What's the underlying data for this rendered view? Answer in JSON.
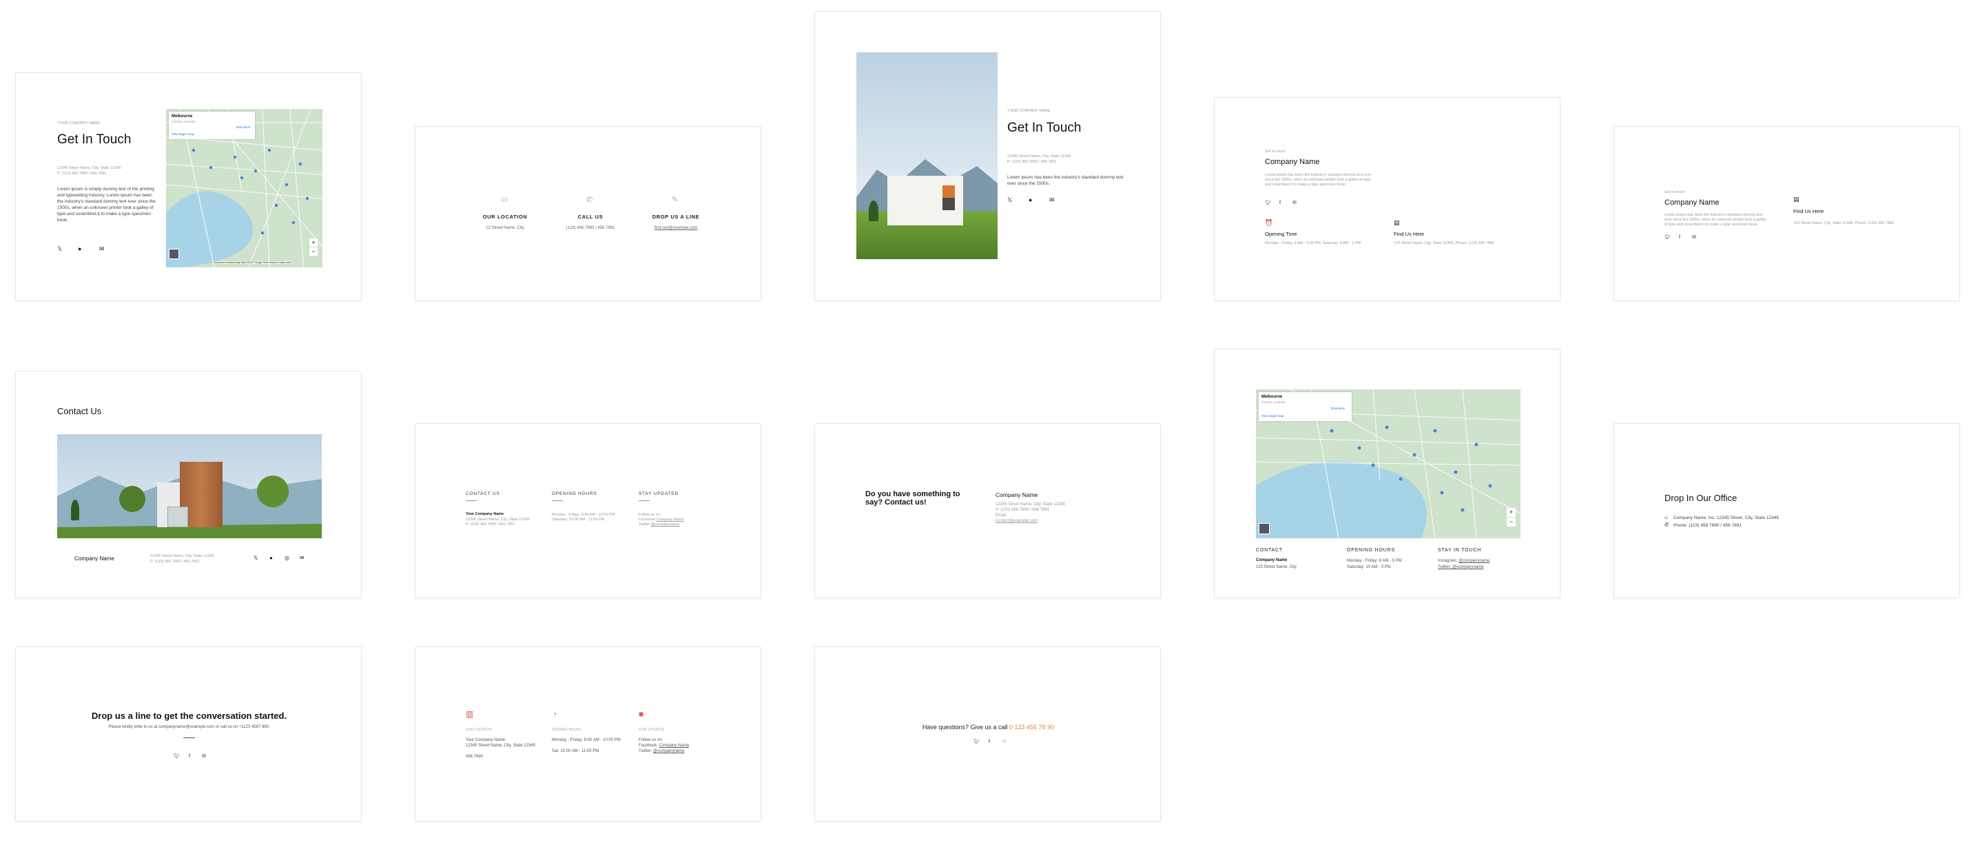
{
  "card1": {
    "eyebrow": "YOUR COMPANY NAME",
    "title": "Get In Touch",
    "addr1": "12345 Street Name, City, State 12345",
    "addr2": "P: (123) 456 7890 / 456 7891",
    "body": "Lorem ipsum is simply dummy text of the printing and typesetting industry. Lorem ipsum has been the industry's standard dummy text ever since the 1500s, when an unknown printer took a galley of type and scrambled it to make a type specimen book.",
    "map_city": "Melbourne",
    "map_region": "Victoria, Australia",
    "map_directions": "Directions",
    "map_view_larger": "View larger map",
    "map_footer": "Keyboard shortcuts   Map data ©2022 Google   Terms   Report a map error"
  },
  "card2": {
    "col1_title": "OUR LOCATION",
    "col1_text": "12 Street Name, City",
    "col2_title": "CALL US",
    "col2_text": "(123) 456 7890 / 456 7891",
    "col3_title": "DROP US A LINE",
    "col3_text": "first.last@example.com"
  },
  "card3": {
    "eyebrow": "YOUR COMPANY NAME",
    "title": "Get In Touch",
    "addr1": "12345 Street Name, City, State 12345",
    "addr2": "P: (123) 456 7890 / 456 7891",
    "body": "Lorem ipsum has been the industry's standard dummy text ever since the 1500s."
  },
  "card4": {
    "eyebrow": "Get in touch",
    "title": "Company Name",
    "body": "Lorem ipsum has been the industry's standard dummy text ever since the 1500s, when an unknown printer took a galley of type and scrambled it to make a type specimen book.",
    "col1_title": "Opening Time",
    "col1_text": "Monday - Friday: 8 AM - 9:30 PM, Saturday: 8 AM - 1 PM",
    "col2_title": "Find Us Here",
    "col2_text": "123 Street Name, City, State 12345, Phone: (123) 456 7890"
  },
  "card5": {
    "eyebrow": "Get in touch",
    "title": "Company Name",
    "body": "Lorem ipsum has been the industry's standard dummy text ever since the 1500s, when an unknown printer took a galley of type and scrambled it to make a type specimen book.",
    "col2_title": "Find Us Here",
    "col2_text": "123 Street Name, City, State 12345, Phone: (123) 456 7890"
  },
  "card6": {
    "title": "Contact Us",
    "company": "Company Name",
    "addr1": "12345 Street Name, City, State 12345",
    "addr2": "P: (123) 456 7890 / 456 7891"
  },
  "card7": {
    "col1_title": "CONTACT US",
    "col1_l1": "Your Company Name",
    "col1_l2": "12345 Street Name, City, State 12345",
    "col1_l3": "P: (123) 456 7890 / 456 7891",
    "col2_title": "OPENING HOURS",
    "col2_l1": "Monday - Friday: 9:00 AM - 10:00 PM",
    "col2_l2": "Saturday: 10:00 AM - 11:00 PM",
    "col3_title": "STAY UPDATED",
    "col3_l1": "Follow us on:",
    "col3_l2a": "Facebook ",
    "col3_l2b": "Company Name",
    "col3_l3a": "Twitter ",
    "col3_l3b": "@companyname"
  },
  "card8": {
    "heading": "Do you have something to say? Contact us!",
    "company": "Company Name",
    "l1": "12345 Street Name, City, State 12345",
    "l2": "P: (123) 456 7890 / 456 7891",
    "l3": "Email:",
    "l4": "contact@example.com"
  },
  "card9": {
    "map_city": "Melbourne",
    "map_region": "Victoria, Australia",
    "map_directions": "Directions",
    "map_view_larger": "View larger map",
    "col1_title": "CONTACT",
    "col1_l1": "Company Name",
    "col1_l2": "123 Street Name, City",
    "col2_title": "OPENING HOURS",
    "col2_l1": "Monday - Friday: 8 AM - 5 PM",
    "col2_l2": "Saturday: 10 AM - 3 PM",
    "col3_title": "STAY IN TOUCH",
    "col3_l1a": "Instagram: ",
    "col3_l1b": "@companyname",
    "col3_l2": "Twitter: @companyname"
  },
  "card10": {
    "title": "Drop In Our Office",
    "l1": "Company Name, Inc. 12345 Street, City, State 12345",
    "l2": "Phone: (123) 456 7890 / 456 7891"
  },
  "card11": {
    "title": "Drop us a line to get the conversation started.",
    "sub": "Please kindly write to us at companyname@example.com or call us on +1123 4567 890."
  },
  "card12": {
    "col1_title": "OUR LOCATION",
    "col1_l1": "Your Company Name",
    "col1_l2": "12345 Street Name, City, State 12345",
    "col1_l3": "456 7890",
    "col2_title": "OPENING HOURS",
    "col2_l1": "Monday - Friday: 9:00 AM - 10:00 PM",
    "col2_l2": "Sat: 10:00 AM - 11:00 PM",
    "col3_title": "STAY UPDATED",
    "col3_l1": "Follow us on:",
    "col3_l2a": "Facebook: ",
    "col3_l2b": "Company Name",
    "col3_l3a": "Twitter: ",
    "col3_l3b": "@companyname"
  },
  "card13": {
    "text": "Have questions? Give us a call ",
    "phone": "0 123 456 78 90"
  },
  "colors": {
    "accent_orange": "#e8833a",
    "accent_red": "#e0564a",
    "map_water": "#a6d4e6",
    "map_land": "#cfe2cc",
    "pin_blue": "#4a7fe0"
  },
  "icons": [
    "x-twitter-icon",
    "facebook-icon",
    "mail-icon",
    "map-icon",
    "phone-icon",
    "edit-icon",
    "clock-icon",
    "calendar-icon",
    "home-icon",
    "twitter-icon",
    "instagram-icon"
  ]
}
